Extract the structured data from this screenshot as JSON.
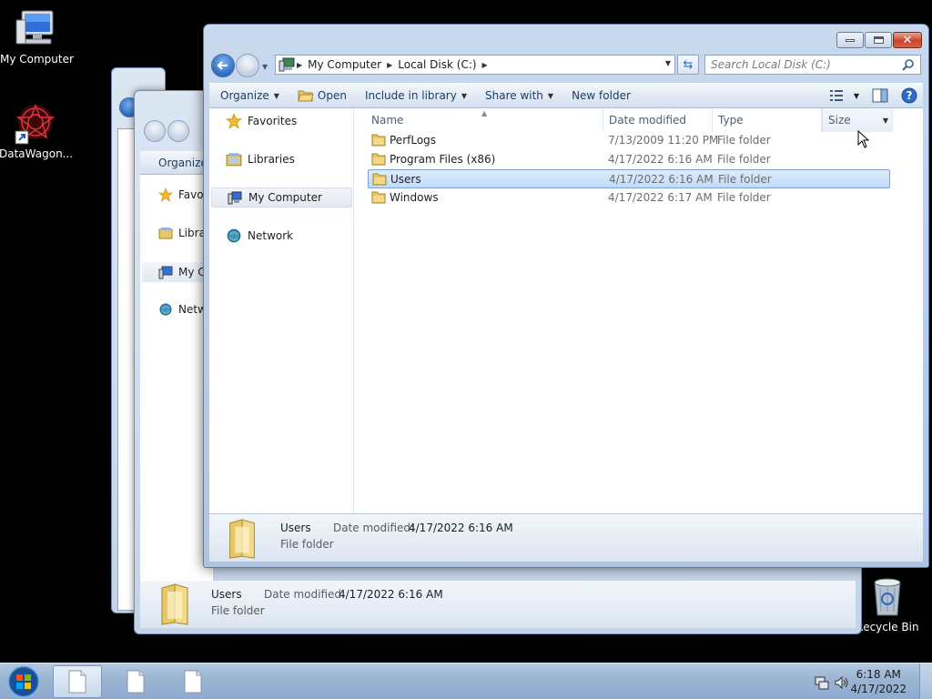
{
  "desktop": {
    "icons": [
      {
        "label": "My Computer"
      },
      {
        "label": "DataWagon..."
      },
      {
        "label": "Recycle Bin"
      }
    ]
  },
  "window": {
    "address": {
      "crumbs": [
        "My Computer",
        "Local Disk (C:)"
      ]
    },
    "search_placeholder": "Search Local Disk (C:)",
    "toolbar": {
      "organize": "Organize",
      "open": "Open",
      "include": "Include in library",
      "share": "Share with",
      "new_folder": "New folder"
    },
    "nav": {
      "favorites": "Favorites",
      "libraries": "Libraries",
      "my_computer": "My Computer",
      "network": "Network"
    },
    "columns": {
      "name": "Name",
      "date": "Date modified",
      "type": "Type",
      "size": "Size"
    },
    "rows": [
      {
        "name": "PerfLogs",
        "date": "7/13/2009 11:20 PM",
        "type": "File folder"
      },
      {
        "name": "Program Files (x86)",
        "date": "4/17/2022 6:16 AM",
        "type": "File folder"
      },
      {
        "name": "Users",
        "date": "4/17/2022 6:16 AM",
        "type": "File folder"
      },
      {
        "name": "Windows",
        "date": "4/17/2022 6:17 AM",
        "type": "File folder"
      }
    ],
    "details": {
      "name": "Users",
      "type": "File folder",
      "date_label": "Date modified:",
      "date_value": "4/17/2022 6:16 AM"
    }
  },
  "bg_window": {
    "organize": "Organize",
    "nav": [
      "Favo",
      "Libra",
      "My C",
      "Netw"
    ],
    "details": {
      "name": "Users",
      "type": "File folder",
      "date_label": "Date modified:",
      "date_value": "4/17/2022 6:16 AM"
    }
  },
  "taskbar": {
    "time": "6:18 AM",
    "date": "4/17/2022"
  },
  "colors": {
    "selection": "#c1dcfc",
    "titlebar": "#bcd0e9",
    "close": "#c7452e"
  }
}
